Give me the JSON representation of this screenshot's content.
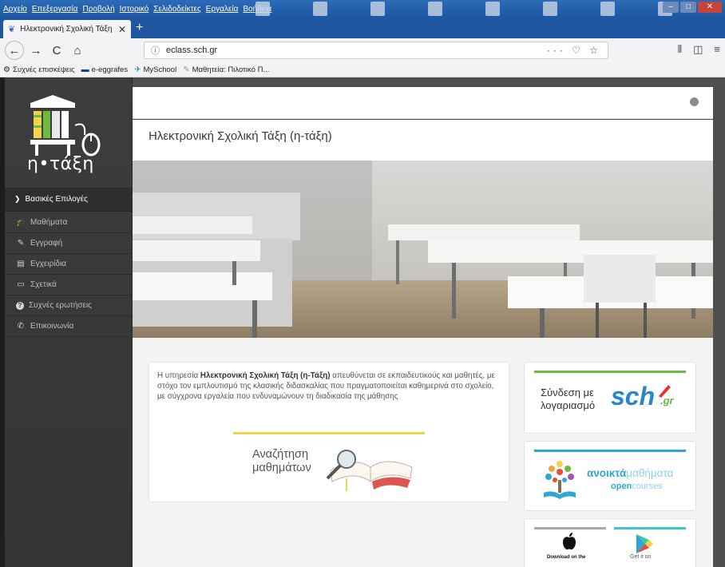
{
  "browser": {
    "menu": [
      "Αρχείο",
      "Επεξεργασία",
      "Προβολή",
      "Ιστορικό",
      "Σελιδοδείκτες",
      "Εργαλεία",
      "Βοήθεια"
    ],
    "tab_title": "Ηλεκτρονική Σχολική Τάξη (η-",
    "tab_close": "✕",
    "new_tab": "+",
    "url": "eclass.sch.gr",
    "page_actions": "··· ♡ ☆",
    "bookmarks": [
      {
        "label": "Συχνές επισκέψεις",
        "icon": "⚙"
      },
      {
        "label": "e-eggrafes",
        "icon": "▬"
      },
      {
        "label": "MySchool",
        "icon": "✈"
      },
      {
        "label": "Μαθητεία: Πιλοτικό Π...",
        "icon": "✎"
      }
    ]
  },
  "sidebar": {
    "logo_text": "η•τάξη",
    "section_title": "Βασικές Επιλογές",
    "items": [
      {
        "label": "Μαθήματα",
        "icon": "🎓"
      },
      {
        "label": "Εγγραφή",
        "icon": "✎"
      },
      {
        "label": "Εγχειρίδια",
        "icon": "▤"
      },
      {
        "label": "Σχετικά",
        "icon": "▭"
      },
      {
        "label": "Συχνές ερωτήσεις",
        "icon": "?"
      },
      {
        "label": "Επικοινωνία",
        "icon": "✆"
      }
    ]
  },
  "main": {
    "site_title": "Ηλεκτρονική Σχολική Τάξη (η-τάξη)",
    "intro_prefix": "Η υπηρεσία ",
    "intro_bold": "Ηλεκτρονική Σχολική Τάξη (η-Τάξη)",
    "intro_rest": " απευθύνεται σε εκπαιδευτικούς και μαθητές, με στόχο τον εμπλουτισμό της κλασικής διδασκαλίας που πραγματοποιείται καθημερινά στο σχολείο, με σύγχρονα εργαλεία που ενδυναμώνουν τη διαδικασία της μάθησης",
    "search_line1": "Αναζήτηση",
    "search_line2": "μαθημάτων"
  },
  "cards": {
    "sch_line1": "Σύνδεση με",
    "sch_line2": "λογαριασμό",
    "sch_logo": "sch",
    "sch_gr": ".gr",
    "oc_bold": "ανοικτά",
    "oc_rest": "μαθήματα",
    "oc_sub_bold": "open",
    "oc_sub_rest": "courses",
    "apple_label": "Download on the",
    "play_label": "Get it on"
  },
  "colors": {
    "sch_green": "#6dbb3e",
    "sch_blue": "#2a86c8",
    "opencourses_blue": "#2fa6d6",
    "search_yellow": "#f1d448"
  }
}
